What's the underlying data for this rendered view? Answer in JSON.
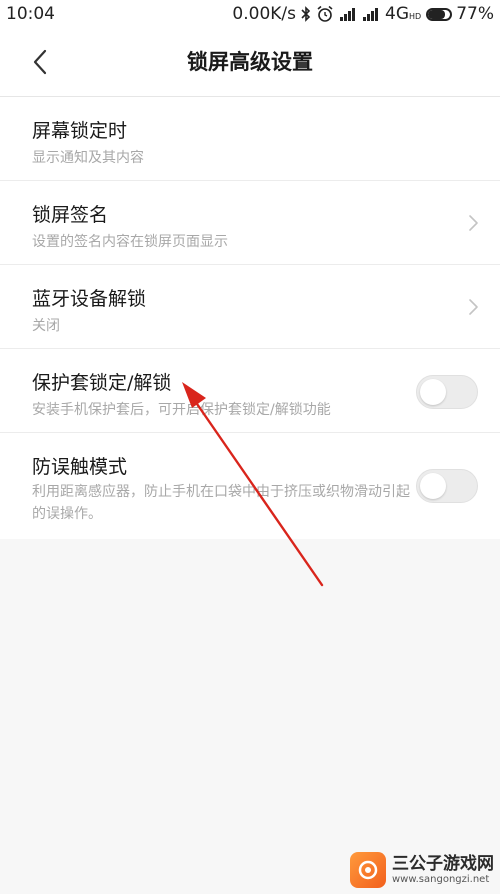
{
  "status_bar": {
    "time": "10:04",
    "network_speed": "0.00K/s",
    "network_type": "4G",
    "network_type_suffix": "HD",
    "battery_percent": "77%",
    "battery_level": 0.77,
    "icons": [
      "bluetooth-icon",
      "alarm-icon",
      "signal-icon",
      "signal-icon",
      "battery-icon"
    ]
  },
  "header": {
    "back_icon": "chevron-left-icon",
    "title": "锁屏高级设置"
  },
  "settings": {
    "items": [
      {
        "title": "屏幕锁定时",
        "description": "显示通知及其内容",
        "control": "none"
      },
      {
        "title": "锁屏签名",
        "description": "设置的签名内容在锁屏页面显示",
        "control": "chevron-right-icon"
      },
      {
        "title": "蓝牙设备解锁",
        "description": "关闭",
        "control": "chevron-right-icon"
      },
      {
        "title": "保护套锁定/解锁",
        "description": "安装手机保护套后，可开启保护套锁定/解锁功能",
        "control": "toggle",
        "toggle_on": false
      },
      {
        "title": "防误触模式",
        "description": "利用距离感应器，防止手机在口袋中由于挤压或织物滑动引起的误操作。",
        "control": "toggle",
        "toggle_on": false
      }
    ]
  },
  "annotation": {
    "color": "#d9251c"
  },
  "watermark": {
    "name": "三公子游戏网",
    "url": "www.sangongzi.net"
  }
}
